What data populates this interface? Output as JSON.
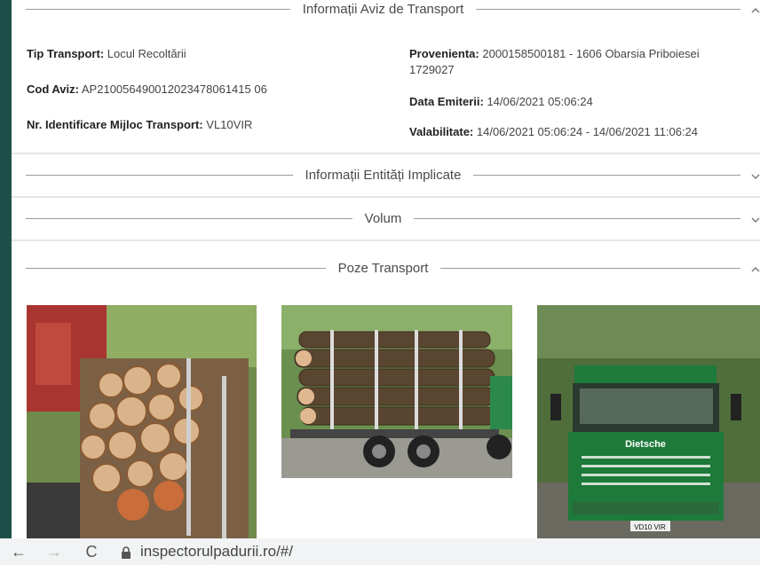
{
  "sections": {
    "aviz": {
      "title": "Informații Aviz de Transport",
      "chevron": "^"
    },
    "entitati": {
      "title": "Informații Entități Implicate",
      "chevron": "v"
    },
    "volum": {
      "title": "Volum",
      "chevron": "v"
    },
    "poze": {
      "title": "Poze Transport",
      "chevron": "^"
    }
  },
  "fields": {
    "tip_transport": {
      "label": "Tip Transport:",
      "value": "Locul Recoltării"
    },
    "cod_aviz": {
      "label": "Cod Aviz:",
      "value": "AP210056490012023478061415 06"
    },
    "nr_identificare": {
      "label": "Nr. Identificare Mijloc Transport:",
      "value": "VL10VIR"
    },
    "provenienta": {
      "label": "Provenienta:",
      "value": "2000158500181 - 1606 Obarsia Priboiesei",
      "value_line2": "1729027"
    },
    "data_emiterii": {
      "label": "Data Emiterii:",
      "value": "14/06/2021 05:06:24"
    },
    "valabilitate": {
      "label": "Valabilitate:",
      "value": "14/06/2021 05:06:24 - 14/06/2021 11:06:24"
    }
  },
  "browser": {
    "url": "inspectorulpadurii.ro/#/",
    "back": "←",
    "forward": "→",
    "reload": "C"
  },
  "photos": {
    "truck_plate": "VD10 VIR",
    "truck_brand": "Dietsche"
  },
  "colors": {
    "sidebar": "#1f4f4b",
    "truck_green": "#1e7a3a",
    "bar_bg": "#f1f3f4"
  }
}
